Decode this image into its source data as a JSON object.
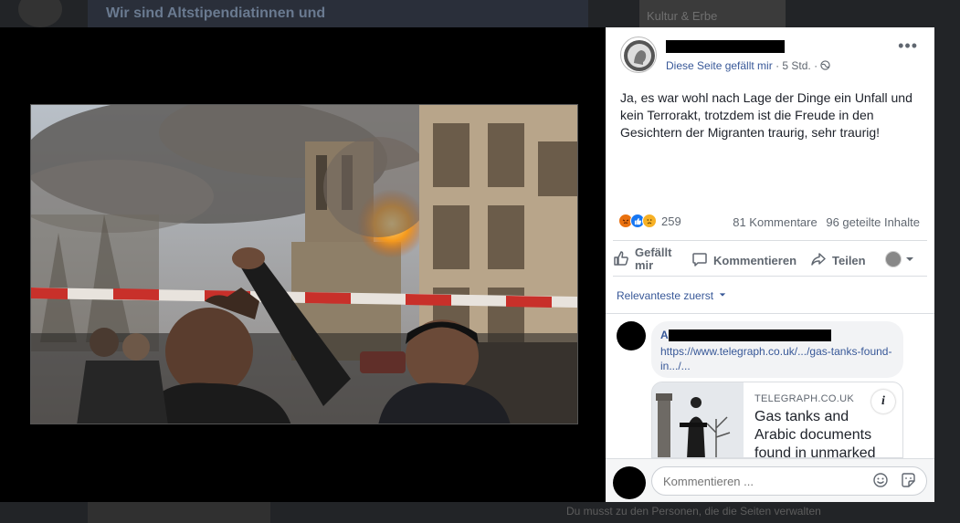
{
  "background": {
    "card_text": "Wir sind Altstipendiatinnen und",
    "right_text": "Kultur & Erbe",
    "bottom_text": "Du musst zu den Personen, die die Seiten verwalten"
  },
  "post": {
    "meta_liked": "Diese Seite gefällt mir",
    "meta_time": "5 Std.",
    "text": "Ja, es war wohl nach Lage der Dinge ein Unfall und kein Terrorakt, trotzdem ist die Freude in den Gesichtern der Migranten traurig, sehr traurig!",
    "reaction_count": "259",
    "comments_count": "81 Kommentare",
    "shares_count": "96 geteilte Inhalte"
  },
  "actions": {
    "like_label": "Gefällt mir",
    "comment_label": "Kommentieren",
    "share_label": "Teilen"
  },
  "comments": {
    "sort_label": "Relevanteste zuerst",
    "items": [
      {
        "author_initial": "A",
        "link_text": "https://www.telegraph.co.uk/.../gas-tanks-found-in.../..."
      }
    ],
    "preview": {
      "domain": "TELEGRAPH.CO.UK",
      "title": "Gas tanks and Arabic documents found in unmarked"
    }
  },
  "composer": {
    "placeholder": "Kommentieren ..."
  },
  "colors": {
    "link": "#385898",
    "like_blue": "#1877f2",
    "angry_orange": "#e9710f",
    "sad_yellow": "#f7b125"
  }
}
